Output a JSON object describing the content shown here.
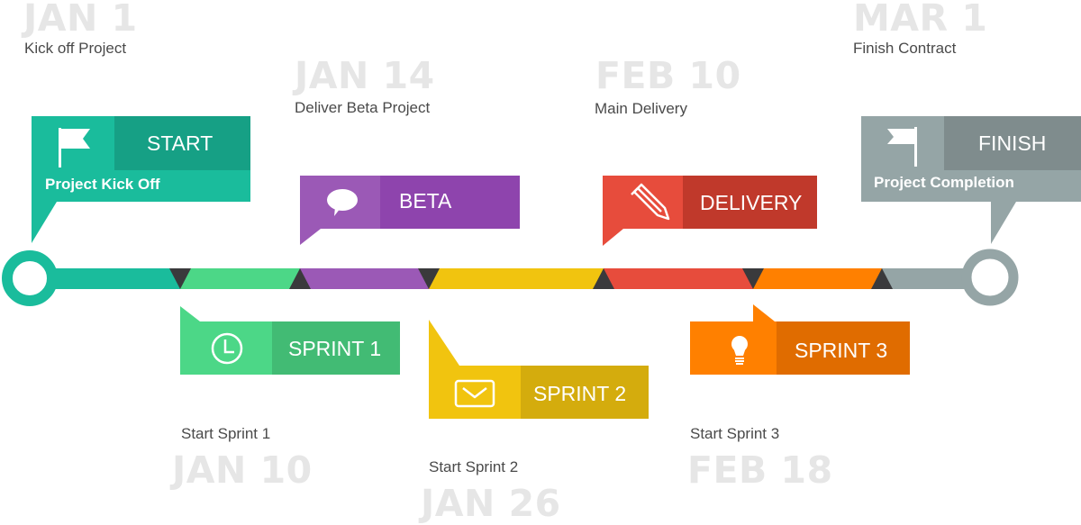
{
  "milestones": [
    {
      "id": "start",
      "date": "JAN 1",
      "caption": "Kick off Project",
      "title": "START",
      "subtitle": "Project Kick Off",
      "icon": "flag-icon",
      "color": "#1abc9c",
      "color_dark": "#16a085"
    },
    {
      "id": "beta",
      "date": "JAN 14",
      "caption": "Deliver Beta Project",
      "title": "BETA",
      "icon": "speech-bubble-icon",
      "color": "#9b59b6",
      "color_dark": "#8e44ad"
    },
    {
      "id": "delivery",
      "date": "FEB 10",
      "caption": "Main Delivery",
      "title": "DELIVERY",
      "icon": "pencil-icon",
      "color": "#e74c3c",
      "color_dark": "#c0392b"
    },
    {
      "id": "finish",
      "date": "MAR 1",
      "caption": "Finish Contract",
      "title": "FINISH",
      "subtitle": "Project Completion",
      "icon": "flag-icon",
      "color": "#95a5a6",
      "color_dark": "#7f8c8d"
    },
    {
      "id": "sprint1",
      "date": "JAN 10",
      "caption": "Start Sprint 1",
      "title": "SPRINT 1",
      "icon": "clock-icon",
      "color": "#4cd787",
      "color_dark": "#42bb74"
    },
    {
      "id": "sprint2",
      "date": "JAN 26",
      "caption": "Start Sprint 2",
      "title": "SPRINT 2",
      "icon": "envelope-icon",
      "color": "#f1c40f",
      "color_dark": "#d4ac0d"
    },
    {
      "id": "sprint3",
      "date": "FEB 18",
      "caption": "Start Sprint 3",
      "title": "SPRINT 3",
      "icon": "lightbulb-icon",
      "color": "#ff8000",
      "color_dark": "#e06c00"
    }
  ],
  "timeline": {
    "segments": [
      {
        "name": "start",
        "color": "#1abc9c"
      },
      {
        "name": "sprint1",
        "color": "#4cd787"
      },
      {
        "name": "beta",
        "color": "#9b59b6"
      },
      {
        "name": "sprint2",
        "color": "#f1c40f"
      },
      {
        "name": "delivery",
        "color": "#e74c3c"
      },
      {
        "name": "sprint3",
        "color": "#ff8000"
      },
      {
        "name": "finish",
        "color": "#95a5a6"
      }
    ],
    "separator_color": "#3a3a3c"
  }
}
